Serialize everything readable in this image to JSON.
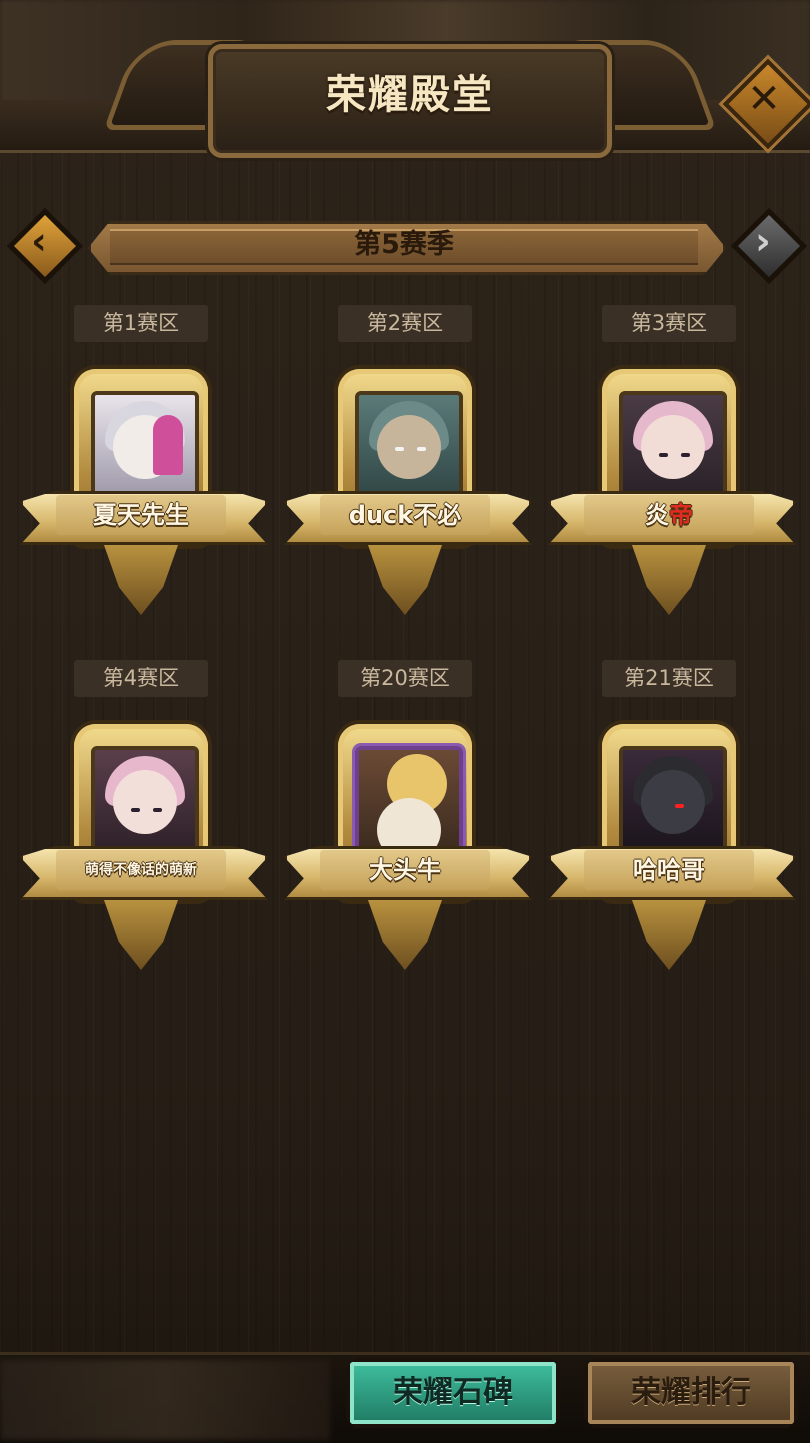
{
  "header": {
    "title": "荣耀殿堂",
    "close_icon": "close-icon"
  },
  "season": {
    "label": "第5赛季",
    "prev_icon": "chevron-left-icon",
    "next_icon": "chevron-right-icon"
  },
  "champions": [
    {
      "zone": "第1赛区",
      "name": "夏天先生",
      "name_highlight": ""
    },
    {
      "zone": "第2赛区",
      "name": "duck不必",
      "name_highlight": ""
    },
    {
      "zone": "第3赛区",
      "name": "炎",
      "name_highlight": "帝"
    },
    {
      "zone": "第4赛区",
      "name": "萌得不像话的萌新",
      "name_highlight": ""
    },
    {
      "zone": "第20赛区",
      "name": "大头牛",
      "name_highlight": ""
    },
    {
      "zone": "第21赛区",
      "name": "哈哈哥",
      "name_highlight": ""
    }
  ],
  "footer": {
    "tabs": [
      {
        "label": "荣耀石碑",
        "active": true
      },
      {
        "label": "荣耀排行",
        "active": false
      }
    ]
  },
  "colors": {
    "active_tab": "#2fa183",
    "highlight_red": "#e02b20",
    "gold": "#d6b66a"
  }
}
